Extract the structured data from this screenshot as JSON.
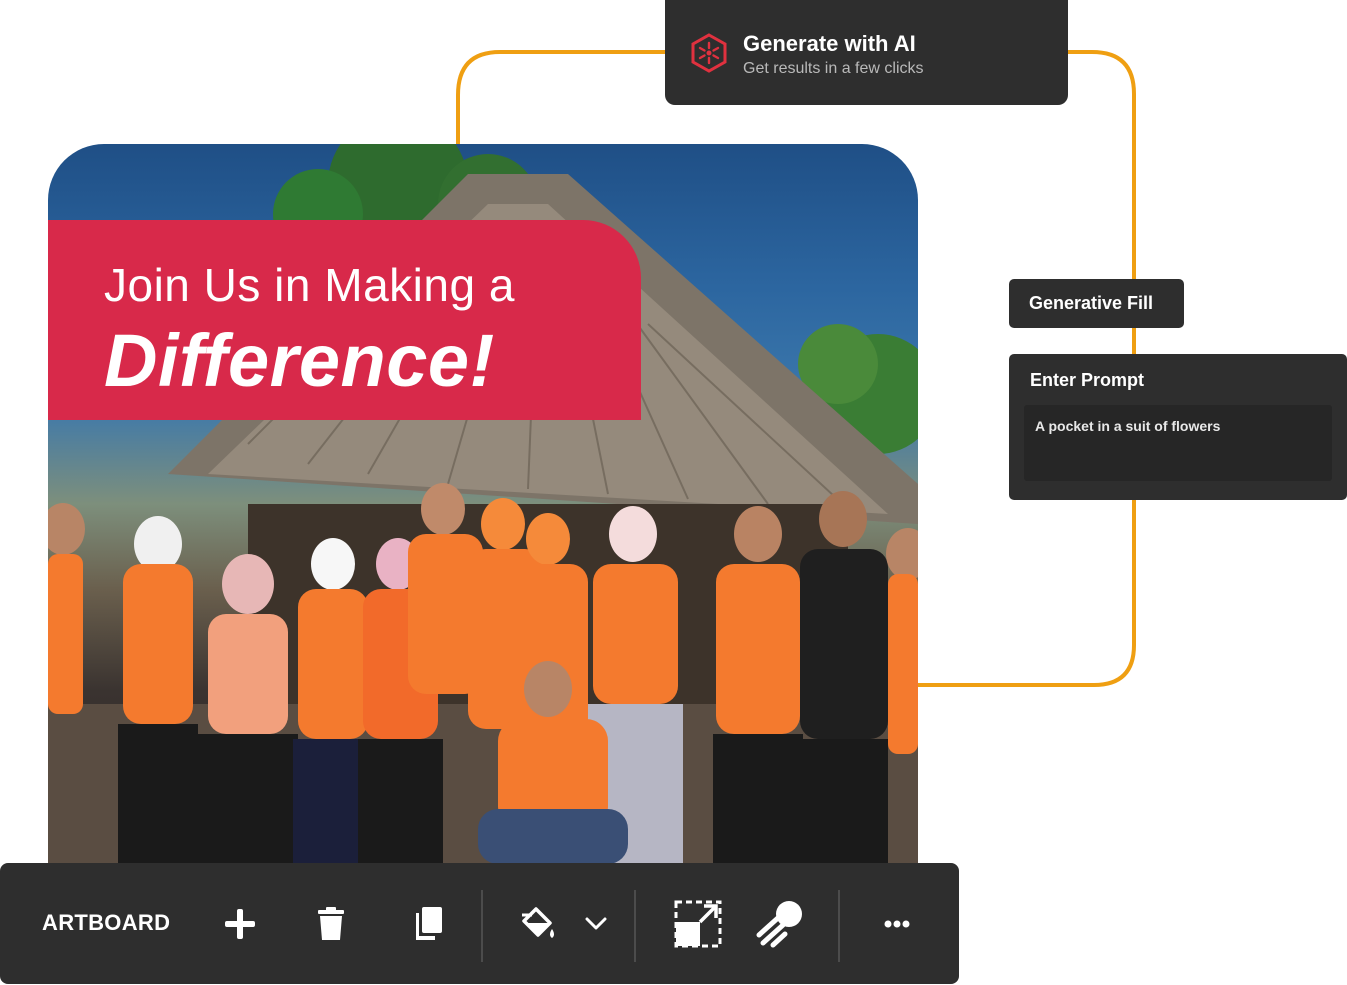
{
  "generate_ai": {
    "title": "Generate with AI",
    "subtitle": "Get results in a few clicks",
    "logo_icon": "hexagon-sparkle-icon",
    "logo_color": "#e0313f"
  },
  "artboard": {
    "banner_line1": "Join Us in Making a",
    "banner_line2": "Difference!",
    "banner_color": "#d8294a",
    "image_description": "group-photo"
  },
  "generative_fill": {
    "label": "Generative Fill"
  },
  "prompt_panel": {
    "label": "Enter Prompt",
    "value": "A pocket in a suit of flowers"
  },
  "toolbar": {
    "label": "ARTBOARD",
    "buttons": [
      {
        "name": "add",
        "icon": "plus-icon"
      },
      {
        "name": "delete",
        "icon": "trash-icon"
      },
      {
        "name": "duplicate",
        "icon": "copy-icon"
      },
      {
        "name": "fill",
        "icon": "paint-bucket-icon"
      },
      {
        "name": "fill-dropdown",
        "icon": "chevron-down-icon"
      },
      {
        "name": "resize",
        "icon": "resize-icon"
      },
      {
        "name": "magic",
        "icon": "comet-icon"
      },
      {
        "name": "more",
        "icon": "more-dots-icon"
      }
    ]
  },
  "colors": {
    "panel_bg": "#2e2e2e",
    "connector": "#ef9f12",
    "accent": "#d8294a"
  }
}
